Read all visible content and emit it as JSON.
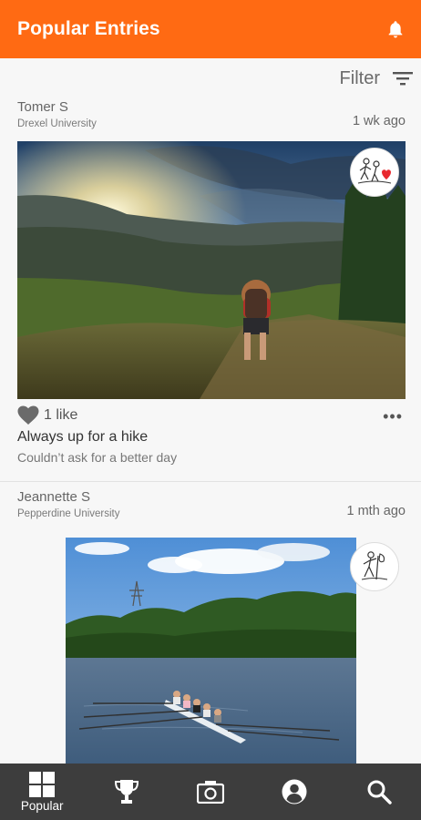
{
  "header": {
    "title": "Popular Entries",
    "accent": "#ff6a13"
  },
  "filter": {
    "label": "Filter"
  },
  "posts": [
    {
      "author": "Tomer S",
      "school": "Drexel University",
      "time": "1 wk ago",
      "likes": "1 like",
      "title": "Always up for a hike",
      "description": "Couldn’t ask for a better day",
      "badge": "hikers-heart-icon"
    },
    {
      "author": "Jeannette S",
      "school": "Pepperdine University",
      "time": "1 mth ago",
      "badge": "hiker-icon"
    }
  ],
  "tabs": [
    {
      "icon": "grid-icon",
      "label": "Popular",
      "active": true
    },
    {
      "icon": "trophy-icon",
      "label": ""
    },
    {
      "icon": "camera-icon",
      "label": ""
    },
    {
      "icon": "profile-icon",
      "label": ""
    },
    {
      "icon": "search-icon",
      "label": ""
    }
  ]
}
